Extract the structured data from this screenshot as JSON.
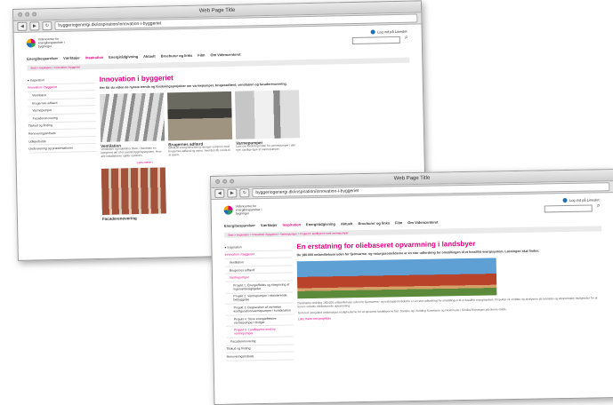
{
  "window_title": "Web Page Title",
  "menu": [
    "Energibesparelser",
    "Værktøjer",
    "Inspiration",
    "Energirådgivning",
    "Aktuelt",
    "Brochurer og links",
    "Film",
    "Om Videncenteret"
  ],
  "logo_text": "Videncenter for energibesparelser i bygninger",
  "login_text": "Log ind på Lineslet",
  "window1": {
    "url": "byggeriogenergi.dk/inspiration/innovation-i-byggeriet",
    "breadcrumb": "Start > Inspiration > Innovation i byggeriet",
    "sidebar": [
      {
        "label": "Inspiration",
        "style": "head"
      },
      {
        "label": "Innovation i byggeriet",
        "style": "pink"
      },
      {
        "label": "Ventilation",
        "style": "indent"
      },
      {
        "label": "Brugernes adfærd",
        "style": "indent"
      },
      {
        "label": "Varmepumper",
        "style": "indent"
      },
      {
        "label": "Facaderenovering",
        "style": "indent"
      },
      {
        "label": "Tilskud og finding",
        "style": "plain"
      },
      {
        "label": "Renoveringsindsats",
        "style": "plain"
      },
      {
        "label": "Udlejerbolde",
        "style": "plain"
      },
      {
        "label": "Undervisning og præsentationer",
        "style": "plain"
      }
    ],
    "heading": "Innovation i byggeriet",
    "lead": "Her får du viden de nyeste trends og forsknings­projekter om varmepumper, brugeradfærd, ventilation og facaderenovering.",
    "cards": [
      {
        "title": "Ventilation",
        "text": "Ventilation og indeklima bliver i fremtiden en integreret del af et samlet bygningssystem. Hvor alle installationer spiller sammen."
      },
      {
        "title": "Brugernes adfærd",
        "text": "Effekt af energirenovering hænger sammen med brugernes adfærd og vaner. Hvordan får vi folk til at spare."
      },
      {
        "title": "Varmepumper",
        "text": "Læs om forskning inden for varmepumper i den nye, særlige type af varmepumper."
      }
    ],
    "more_label": "Læs mere",
    "card4_title": "Facaderenovering"
  },
  "window2": {
    "url": "byggeriogenergi.dk/inspiration/innovation-i-byggeriet",
    "breadcrumb": "Start > Inspiration > Innovation i byggeriet > Varmepumper > Projekt 5: landbyerne med varmepumper",
    "sidebar": [
      {
        "label": "Inspiration",
        "style": "head"
      },
      {
        "label": "Innovation i byggeriet",
        "style": "pink"
      },
      {
        "label": "Ventilation",
        "style": "indent"
      },
      {
        "label": "Brugernes adfærd",
        "style": "indent"
      },
      {
        "label": "Varmepumper",
        "style": "indent pink"
      },
      {
        "label": "Projekt 1: Energieffektiv og integrering af ingeniørbesigtigelse",
        "style": "indent2"
      },
      {
        "label": "Projekt 2: Varmepumper i eksisterende bebyggelse",
        "style": "indent2"
      },
      {
        "label": "Projekt 3: Besparelser af varmelse konfiguration/varmepumper i kombination",
        "style": "indent2"
      },
      {
        "label": "Projekt 4: Store energieffektive varmepumper i boliger",
        "style": "indent2"
      },
      {
        "label": "Projekt 5: Landbyerne med ny varmepumper",
        "style": "indent2 pink"
      },
      {
        "label": "Facaderenovering",
        "style": "indent"
      },
      {
        "label": "Tilskud og finding",
        "style": "plain"
      },
      {
        "label": "Renoveringsindsats",
        "style": "plain"
      }
    ],
    "heading": "En erstatning for oliebaseret opvarmning i landsbyer",
    "lead": "De 180.000 enfamiliehuse uden for fjernvarme- og naturgasområderne er en stor udfordring for omstillingen til et fossilfrit energisystem. Løsningen skal findes.",
    "body1": "Danmarks omkring 180.000 enfamiliehuse uden for fjernvarme- og naturgasområderne er en stor udfordring for omstillingen til et fossilfrit energisystem. Projektet vil omfatte og analysere de tekniske og økonomiske muligheder for at levere enkelte oliebaserede opvarmning.",
    "body2": "Som led i projektet undersøges mulighederne for at opvarme landsbyerne fæl. Danske og i Kolding Kommune og i kommune i Sindes Kommune på denne måde.",
    "more_label": "Læs mere om projektet"
  }
}
